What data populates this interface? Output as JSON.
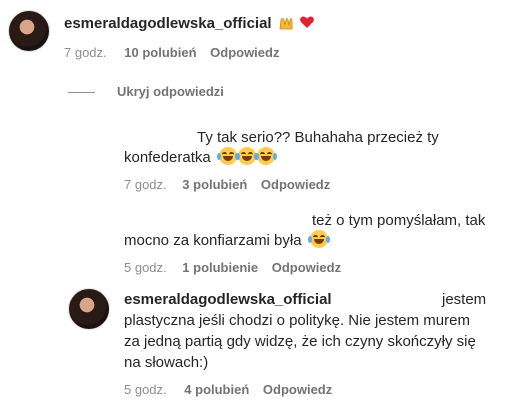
{
  "top_comment": {
    "username": "esmeraldagodlewska_official",
    "emoji_icons": [
      "raising-hands-emoji",
      "red-heart-emoji"
    ],
    "time": "7 godz.",
    "likes": "10 polubień",
    "reply_label": "Odpowiedz"
  },
  "hide_replies_label": "Ukryj odpowiedzi",
  "reply1": {
    "line1": "Ty tak serio?? Buhahaha przecież ty",
    "line2": "konfederatka",
    "time": "7 godz.",
    "likes": "3 polubień",
    "reply_label": "Odpowiedz"
  },
  "reply2": {
    "line1": "też o tym pomyślałam, tak",
    "line2": "mocno za konfiarzami była",
    "time": "5 godz.",
    "likes": "1 polubienie",
    "reply_label": "Odpowiedz"
  },
  "reply3": {
    "username": "esmeraldagodlewska_official",
    "line1_end": "jestem",
    "line2": "plastyczna jeśli chodzi o politykę. Nie jestem murem",
    "line3": "za jedną partią gdy widzę, że ich czyny skończyły się",
    "line4": "na słowach:)",
    "time": "5 godz.",
    "likes": "4 polubień",
    "reply_label": "Odpowiedz"
  }
}
